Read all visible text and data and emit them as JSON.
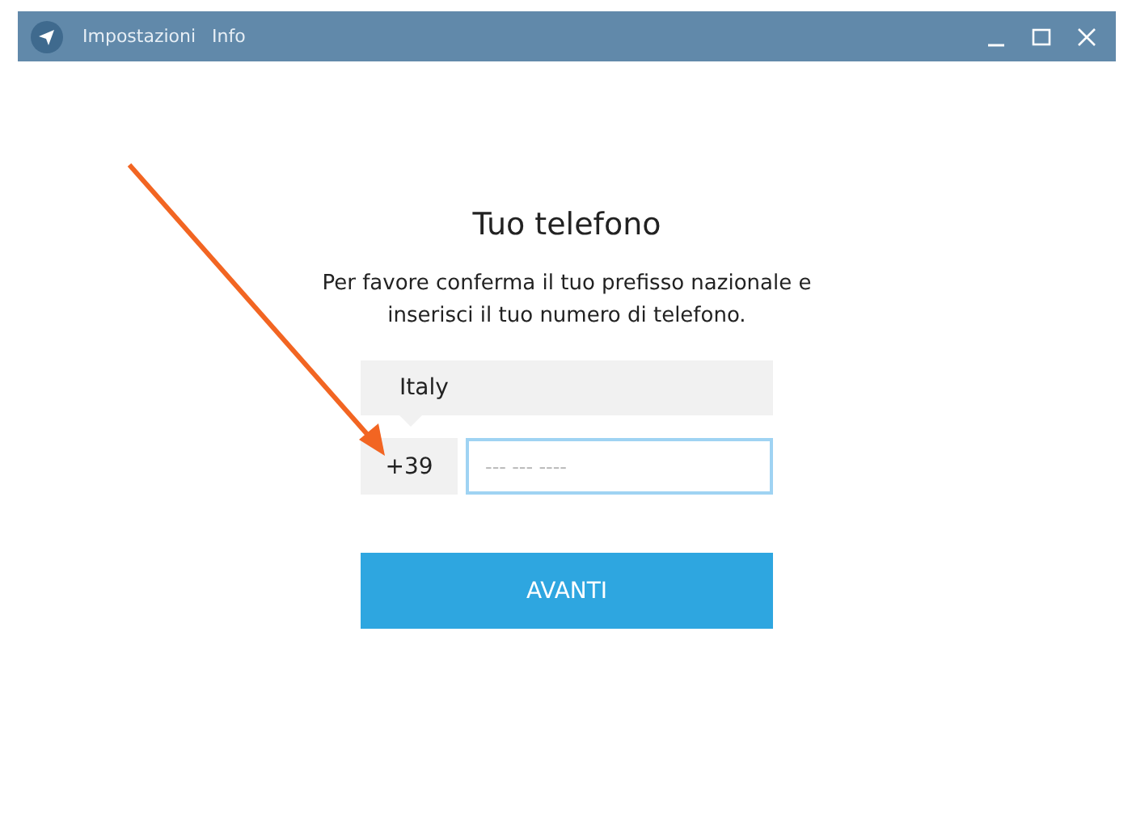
{
  "window": {
    "menu": [
      "Impostazioni",
      "Info"
    ]
  },
  "login": {
    "title": "Tuo telefono",
    "description": "Per favore conferma il tuo prefisso nazionale e inserisci il tuo numero di telefono.",
    "country": "Italy",
    "code": "+39",
    "phone": {
      "placeholder": "--- --- ----",
      "focused": true
    },
    "button": "AVANTI"
  }
}
